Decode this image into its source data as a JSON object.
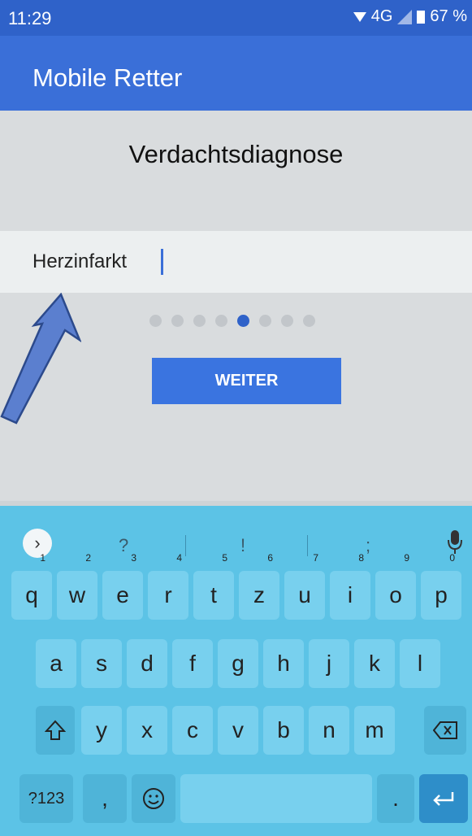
{
  "status": {
    "time": "11:29",
    "network": "4G",
    "battery": "67 %"
  },
  "appbar": {
    "title": "Mobile Retter"
  },
  "page": {
    "heading": "Verdachtsdiagnose"
  },
  "input": {
    "value": "Herzinfarkt"
  },
  "pager": {
    "count": 8,
    "active_index": 4
  },
  "button": {
    "label": "WEITER"
  },
  "keyboard": {
    "suggestions": [
      "?",
      "!",
      ";"
    ],
    "row1": [
      {
        "key": "q",
        "alt": "1"
      },
      {
        "key": "w",
        "alt": "2"
      },
      {
        "key": "e",
        "alt": "3"
      },
      {
        "key": "r",
        "alt": "4"
      },
      {
        "key": "t",
        "alt": "5"
      },
      {
        "key": "z",
        "alt": "6"
      },
      {
        "key": "u",
        "alt": "7"
      },
      {
        "key": "i",
        "alt": "8"
      },
      {
        "key": "o",
        "alt": "9"
      },
      {
        "key": "p",
        "alt": "0"
      }
    ],
    "row2": [
      "a",
      "s",
      "d",
      "f",
      "g",
      "h",
      "j",
      "k",
      "l"
    ],
    "row3": [
      "y",
      "x",
      "c",
      "v",
      "b",
      "n",
      "m"
    ],
    "symbols_label": "?123",
    "comma": ",",
    "period": "."
  },
  "icons": {
    "shift": "shift-icon",
    "backspace": "backspace-icon",
    "emoji": "emoji-icon",
    "enter": "enter-icon",
    "mic": "mic-icon",
    "chevron": "chevron-right-icon"
  },
  "colors": {
    "appbar": "#3a6fd8",
    "accent": "#2f62c9",
    "keyboard": "#5cc3e6"
  }
}
